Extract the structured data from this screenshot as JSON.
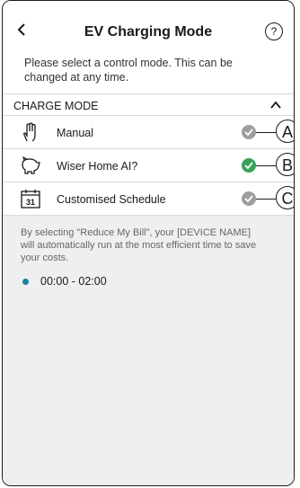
{
  "header": {
    "title": "EV Charging Mode",
    "back_icon": "back-chevron-icon",
    "help_icon": "help-icon"
  },
  "subtitle": "Please select a control mode. This can be changed at any time.",
  "section": {
    "label": "CHARGE MODE",
    "expanded": true
  },
  "modes": [
    {
      "label": "Manual",
      "icon": "hand-icon",
      "selected": false,
      "callout": "A"
    },
    {
      "label": "Wiser Home AI?",
      "icon": "piggy-bank-icon",
      "selected": true,
      "callout": "B"
    },
    {
      "label": "Customised Schedule",
      "icon": "calendar-31-icon",
      "selected": false,
      "callout": "C"
    }
  ],
  "info": {
    "text": "By selecting \"Reduce My Bill\", your [DEVICE NAME] will automatically run at the most efficient time to save your costs.",
    "time_range": "00:00 - 02:00"
  },
  "colors": {
    "selected_check": "#3aa15a",
    "unselected_check": "#9e9e9e",
    "bullet": "#1a7fa0"
  }
}
